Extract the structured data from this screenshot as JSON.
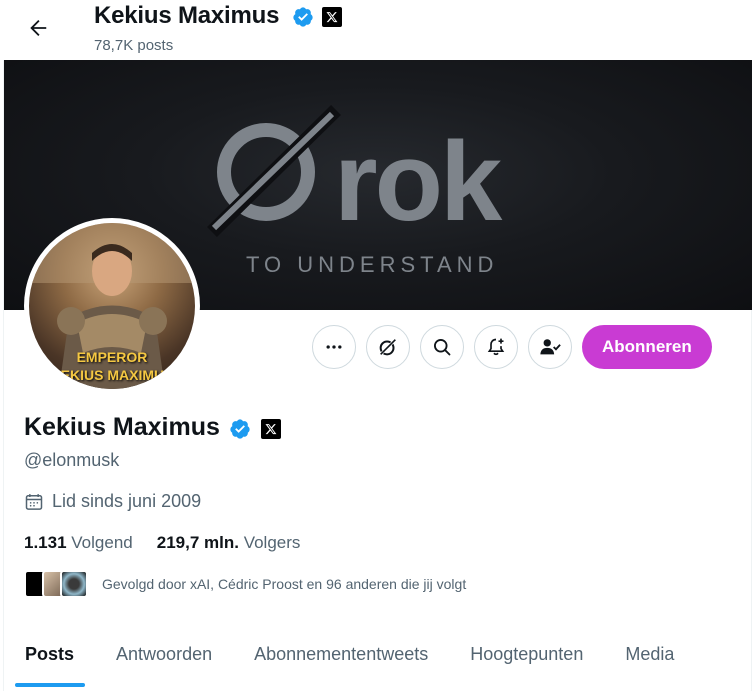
{
  "header": {
    "name": "Kekius Maximus",
    "posts": "78,7K posts"
  },
  "banner": {
    "logo_text": "rok",
    "tagline": "TO UNDERSTAND"
  },
  "avatar": {
    "line1": "EMPEROR",
    "line2": "KEKIUS MAXIMUS"
  },
  "actions": {
    "subscribe_label": "Abonneren"
  },
  "profile": {
    "name": "Kekius Maximus",
    "handle": "@elonmusk",
    "joined": "Lid sinds juni 2009",
    "following_count": "1.131",
    "following_label": "Volgend",
    "followers_count": "219,7 mln.",
    "followers_label": "Volgers",
    "followed_by": "Gevolgd door xAI, Cédric Proost en 96 anderen die jij volgt"
  },
  "tabs": [
    {
      "label": "Posts"
    },
    {
      "label": "Antwoorden"
    },
    {
      "label": "Abonnemententweets"
    },
    {
      "label": "Hoogtepunten"
    },
    {
      "label": "Media"
    }
  ],
  "colors": {
    "accent": "#1d9bf0",
    "subscribe": "#c93bd3",
    "verified": "#1d9bf0",
    "secondary_text": "#536471"
  }
}
